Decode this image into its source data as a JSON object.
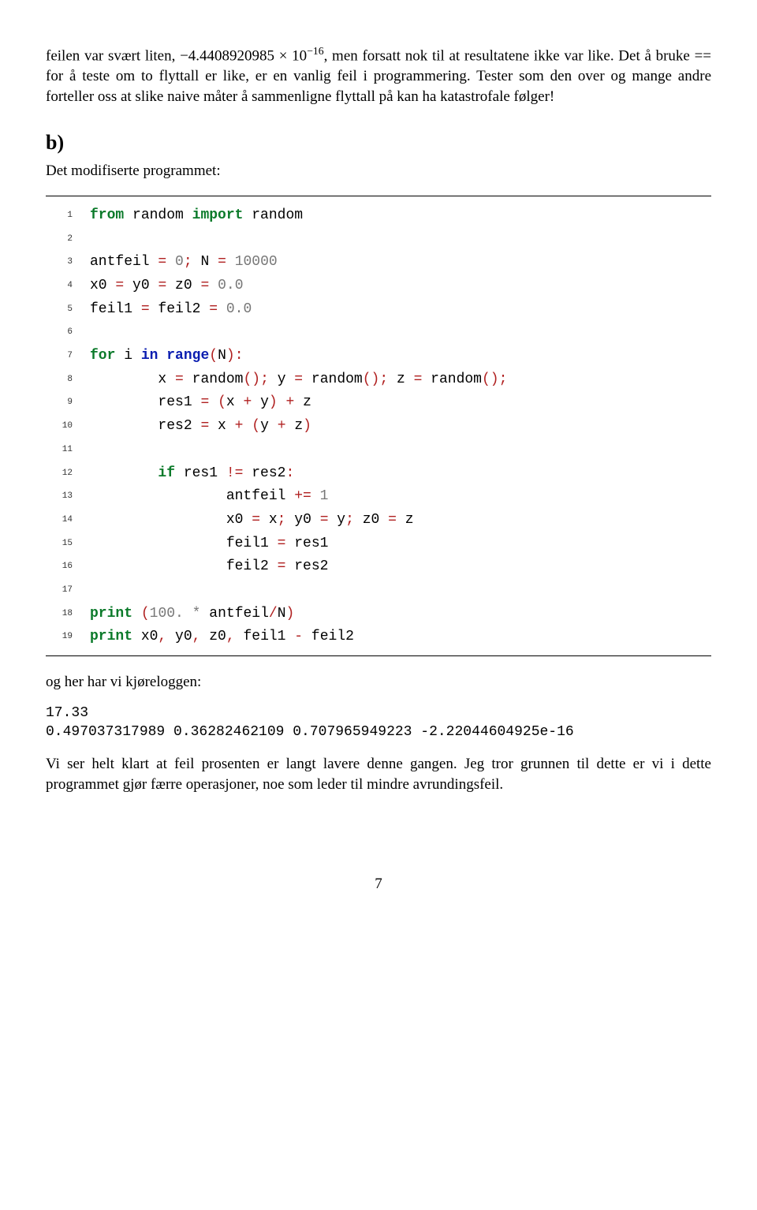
{
  "intro": {
    "p1_prefix": "feilen var svært liten, −4.4408920985 × 10",
    "p1_exp": "−16",
    "p1_suffix": ", men forsatt nok til at resultatene ikke var like. Det å bruke == for å teste om to flyttall er like, er en vanlig feil i programmering. Tester som den over og mange andre forteller oss at slike naive måter å sammenligne flyttall på kan ha katastrofale følger!"
  },
  "section": {
    "label": "b)",
    "subtitle": "Det modifiserte programmet:"
  },
  "code": {
    "lines": [
      {
        "n": "1",
        "tokens": [
          [
            "kw-green",
            "from"
          ],
          [
            "",
            " random "
          ],
          [
            "kw-green",
            "import"
          ],
          [
            "",
            " random"
          ]
        ]
      },
      {
        "n": "2",
        "tokens": [
          [
            "",
            ""
          ]
        ]
      },
      {
        "n": "3",
        "tokens": [
          [
            "",
            "antfeil "
          ],
          [
            "sym-red",
            "="
          ],
          [
            "",
            " "
          ],
          [
            "num-grey",
            "0"
          ],
          [
            "sym-red",
            ";"
          ],
          [
            "",
            " N "
          ],
          [
            "sym-red",
            "="
          ],
          [
            "",
            " "
          ],
          [
            "num-grey",
            "10000"
          ]
        ]
      },
      {
        "n": "4",
        "tokens": [
          [
            "",
            "x0 "
          ],
          [
            "sym-red",
            "="
          ],
          [
            "",
            " y0 "
          ],
          [
            "sym-red",
            "="
          ],
          [
            "",
            " z0 "
          ],
          [
            "sym-red",
            "="
          ],
          [
            "",
            " "
          ],
          [
            "num-grey",
            "0.0"
          ]
        ]
      },
      {
        "n": "5",
        "tokens": [
          [
            "",
            "feil1 "
          ],
          [
            "sym-red",
            "="
          ],
          [
            "",
            " feil2 "
          ],
          [
            "sym-red",
            "="
          ],
          [
            "",
            " "
          ],
          [
            "num-grey",
            "0.0"
          ]
        ]
      },
      {
        "n": "6",
        "tokens": [
          [
            "",
            ""
          ]
        ]
      },
      {
        "n": "7",
        "tokens": [
          [
            "kw-green",
            "for"
          ],
          [
            "",
            " i "
          ],
          [
            "kw-blue",
            "in"
          ],
          [
            "",
            " "
          ],
          [
            "kw-blue",
            "range"
          ],
          [
            "sym-red",
            "("
          ],
          [
            "",
            "N"
          ],
          [
            "sym-red",
            ")"
          ],
          [
            "sym-red",
            ":"
          ]
        ]
      },
      {
        "n": "8",
        "tokens": [
          [
            "",
            "        x "
          ],
          [
            "sym-red",
            "="
          ],
          [
            "",
            " random"
          ],
          [
            "sym-red",
            "()"
          ],
          [
            "sym-red",
            ";"
          ],
          [
            "",
            " y "
          ],
          [
            "sym-red",
            "="
          ],
          [
            "",
            " random"
          ],
          [
            "sym-red",
            "()"
          ],
          [
            "sym-red",
            ";"
          ],
          [
            "",
            " z "
          ],
          [
            "sym-red",
            "="
          ],
          [
            "",
            " random"
          ],
          [
            "sym-red",
            "()"
          ],
          [
            "sym-red",
            ";"
          ]
        ]
      },
      {
        "n": "9",
        "tokens": [
          [
            "",
            "        res1 "
          ],
          [
            "sym-red",
            "="
          ],
          [
            "",
            " "
          ],
          [
            "sym-red",
            "("
          ],
          [
            "",
            "x "
          ],
          [
            "sym-red",
            "+"
          ],
          [
            "",
            " y"
          ],
          [
            "sym-red",
            ")"
          ],
          [
            "",
            " "
          ],
          [
            "sym-red",
            "+"
          ],
          [
            "",
            " z"
          ]
        ]
      },
      {
        "n": "10",
        "tokens": [
          [
            "",
            "        res2 "
          ],
          [
            "sym-red",
            "="
          ],
          [
            "",
            " x "
          ],
          [
            "sym-red",
            "+"
          ],
          [
            "",
            " "
          ],
          [
            "sym-red",
            "("
          ],
          [
            "",
            "y "
          ],
          [
            "sym-red",
            "+"
          ],
          [
            "",
            " z"
          ],
          [
            "sym-red",
            ")"
          ]
        ]
      },
      {
        "n": "11",
        "tokens": [
          [
            "",
            ""
          ]
        ]
      },
      {
        "n": "12",
        "tokens": [
          [
            "",
            "        "
          ],
          [
            "kw-green",
            "if"
          ],
          [
            "",
            " res1 "
          ],
          [
            "sym-red",
            "!="
          ],
          [
            "",
            " res2"
          ],
          [
            "sym-red",
            ":"
          ]
        ]
      },
      {
        "n": "13",
        "tokens": [
          [
            "",
            "                antfeil "
          ],
          [
            "sym-red",
            "+="
          ],
          [
            "",
            " "
          ],
          [
            "num-grey",
            "1"
          ]
        ]
      },
      {
        "n": "14",
        "tokens": [
          [
            "",
            "                x0 "
          ],
          [
            "sym-red",
            "="
          ],
          [
            "",
            " x"
          ],
          [
            "sym-red",
            ";"
          ],
          [
            "",
            " y0 "
          ],
          [
            "sym-red",
            "="
          ],
          [
            "",
            " y"
          ],
          [
            "sym-red",
            ";"
          ],
          [
            "",
            " z0 "
          ],
          [
            "sym-red",
            "="
          ],
          [
            "",
            " z"
          ]
        ]
      },
      {
        "n": "15",
        "tokens": [
          [
            "",
            "                feil1 "
          ],
          [
            "sym-red",
            "="
          ],
          [
            "",
            " res1"
          ]
        ]
      },
      {
        "n": "16",
        "tokens": [
          [
            "",
            "                feil2 "
          ],
          [
            "sym-red",
            "="
          ],
          [
            "",
            " res2"
          ]
        ]
      },
      {
        "n": "17",
        "tokens": [
          [
            "",
            ""
          ]
        ]
      },
      {
        "n": "18",
        "tokens": [
          [
            "kw-green",
            "print"
          ],
          [
            "",
            " "
          ],
          [
            "sym-red",
            "("
          ],
          [
            "num-grey",
            "100."
          ],
          [
            "",
            " "
          ],
          [
            "star",
            "*"
          ],
          [
            "",
            " antfeil"
          ],
          [
            "sym-red",
            "/"
          ],
          [
            "",
            "N"
          ],
          [
            "sym-red",
            ")"
          ]
        ]
      },
      {
        "n": "19",
        "tokens": [
          [
            "kw-green",
            "print"
          ],
          [
            "",
            " x0"
          ],
          [
            "sym-red",
            ","
          ],
          [
            "",
            " y0"
          ],
          [
            "sym-red",
            ","
          ],
          [
            "",
            " z0"
          ],
          [
            "sym-red",
            ","
          ],
          [
            "",
            " feil1 "
          ],
          [
            "sym-red",
            "-"
          ],
          [
            "",
            " feil2"
          ]
        ]
      }
    ]
  },
  "runlog": {
    "caption": "og her har vi kjøreloggen:",
    "output": "17.33\n0.497037317989 0.36282462109 0.707965949223 -2.22044604925e-16"
  },
  "conclusion": "Vi ser helt klart at feil prosenten er langt lavere denne gangen. Jeg tror grunnen til dette er vi i dette programmet gjør færre operasjoner, noe som leder til mindre avrundingsfeil.",
  "page": "7"
}
